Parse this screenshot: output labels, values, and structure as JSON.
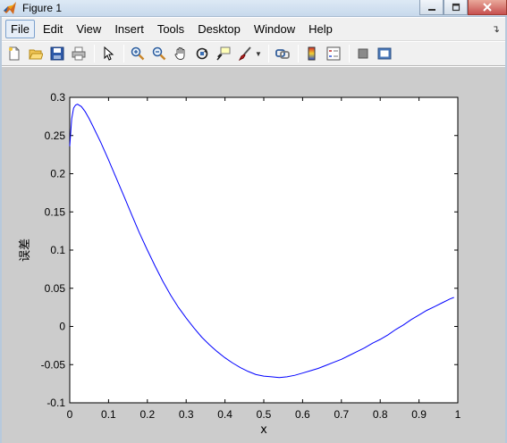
{
  "window": {
    "title": "Figure 1"
  },
  "menu": {
    "items": [
      "File",
      "Edit",
      "View",
      "Insert",
      "Tools",
      "Desktop",
      "Window",
      "Help"
    ],
    "active_index": 0,
    "overflow_icon": "curved-arrow-icon"
  },
  "toolbar": {
    "icons": [
      "new-figure-icon",
      "open-file-icon",
      "save-icon",
      "print-icon",
      "edit-plot-arrow-icon",
      "zoom-in-icon",
      "zoom-out-icon",
      "pan-hand-icon",
      "rotate-3d-icon",
      "data-cursor-icon",
      "brush-icon",
      "link-plot-icon",
      "colorbar-icon",
      "legend-icon",
      "hide-plot-tools-icon",
      "show-plot-tools-icon"
    ]
  },
  "colors": {
    "line": "#0000ff",
    "figure_background": "#cccccc",
    "axes_background": "#ffffff"
  },
  "chart_data": {
    "type": "line",
    "xlabel": "x",
    "ylabel": "误差",
    "xlim": [
      0,
      1
    ],
    "ylim": [
      -0.1,
      0.3
    ],
    "xticks": [
      "0",
      "0.1",
      "0.2",
      "0.3",
      "0.4",
      "0.5",
      "0.6",
      "0.7",
      "0.8",
      "0.9",
      "1"
    ],
    "yticks": [
      "-0.1",
      "-0.05",
      "0",
      "0.05",
      "0.1",
      "0.15",
      "0.2",
      "0.25",
      "0.3"
    ],
    "grid": false,
    "series": [
      {
        "color": "#0000ff",
        "x": [
          0.0,
          0.005,
          0.01,
          0.015,
          0.02,
          0.03,
          0.04,
          0.05,
          0.06,
          0.08,
          0.1,
          0.12,
          0.14,
          0.16,
          0.18,
          0.2,
          0.22,
          0.24,
          0.26,
          0.28,
          0.3,
          0.32,
          0.34,
          0.36,
          0.38,
          0.4,
          0.42,
          0.44,
          0.46,
          0.48,
          0.5,
          0.52,
          0.54,
          0.56,
          0.58,
          0.6,
          0.62,
          0.64,
          0.66,
          0.68,
          0.7,
          0.72,
          0.74,
          0.76,
          0.78,
          0.8,
          0.82,
          0.84,
          0.86,
          0.88,
          0.9,
          0.92,
          0.94,
          0.96,
          0.98,
          0.99
        ],
        "y": [
          0.236,
          0.272,
          0.286,
          0.29,
          0.291,
          0.288,
          0.281,
          0.272,
          0.262,
          0.241,
          0.218,
          0.194,
          0.17,
          0.146,
          0.122,
          0.1,
          0.079,
          0.059,
          0.041,
          0.025,
          0.011,
          -0.002,
          -0.014,
          -0.024,
          -0.033,
          -0.041,
          -0.048,
          -0.054,
          -0.059,
          -0.063,
          -0.065,
          -0.066,
          -0.067,
          -0.066,
          -0.064,
          -0.061,
          -0.058,
          -0.055,
          -0.051,
          -0.047,
          -0.043,
          -0.038,
          -0.033,
          -0.028,
          -0.022,
          -0.017,
          -0.011,
          -0.004,
          0.002,
          0.009,
          0.015,
          0.021,
          0.026,
          0.031,
          0.036,
          0.038
        ]
      }
    ]
  }
}
